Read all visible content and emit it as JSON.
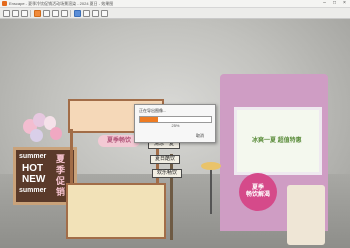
{
  "window": {
    "title": "Enscape - 夏季冷饮促销活动场景渲染 - 2024 夏日 - 效果图",
    "minimize_glyph": "–",
    "maximize_glyph": "□",
    "close_glyph": "×"
  },
  "dialog": {
    "title": "正在导出图像...",
    "progress_percent": 25,
    "progress_label": "25%",
    "cancel_label": "取消"
  },
  "scene": {
    "board_lines": [
      "summer",
      "HOT",
      "NEW",
      "summer"
    ],
    "board_side_lines": [
      "夏",
      "季",
      "促",
      "销"
    ],
    "cart_sign": "夏季畅饮",
    "signs": [
      "清凉一夏",
      "夏日酷饮",
      "欢乐畅饮"
    ],
    "kiosk_screen_text": "冰爽一夏 超值特惠",
    "kiosk_circle_lines": [
      "夏季",
      "畅饮解渴"
    ]
  },
  "colors": {
    "progress_fill": "#ee7b22",
    "kiosk": "#cf9dc4",
    "kiosk_circle": "#d54a8a"
  }
}
